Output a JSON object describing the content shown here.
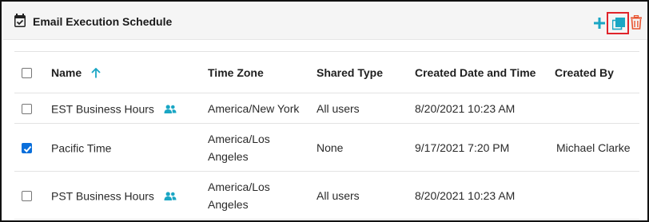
{
  "panel": {
    "title": "Email Execution Schedule",
    "actions": {
      "add": "add-icon",
      "copy": "copy-icon",
      "delete": "trash-icon"
    },
    "colors": {
      "accent": "#1aa6c4",
      "danger": "#e8532f",
      "highlight": "#e0242b",
      "checkbox": "#0a6fdb"
    }
  },
  "table": {
    "columns": {
      "name": "Name",
      "time_zone": "Time Zone",
      "shared_type": "Shared Type",
      "created": "Created Date and Time",
      "created_by": "Created By"
    },
    "sort": {
      "column": "Name",
      "direction": "ascending"
    },
    "rows": [
      {
        "checked": false,
        "name": "EST Business Hours",
        "shared": true,
        "time_zone": "America/New York",
        "shared_type": "All users",
        "created": "8/20/2021 10:23 AM",
        "created_by": ""
      },
      {
        "checked": true,
        "name": "Pacific Time",
        "shared": false,
        "time_zone_line1": "America/Los",
        "time_zone_line2": "Angeles",
        "shared_type": "None",
        "created": "9/17/2021 7:20 PM",
        "created_by": "Michael Clarke"
      },
      {
        "checked": false,
        "name": "PST Business Hours",
        "shared": true,
        "time_zone_line1": "America/Los",
        "time_zone_line2": "Angeles",
        "shared_type": "All users",
        "created": "8/20/2021 10:23 AM",
        "created_by": ""
      }
    ]
  }
}
